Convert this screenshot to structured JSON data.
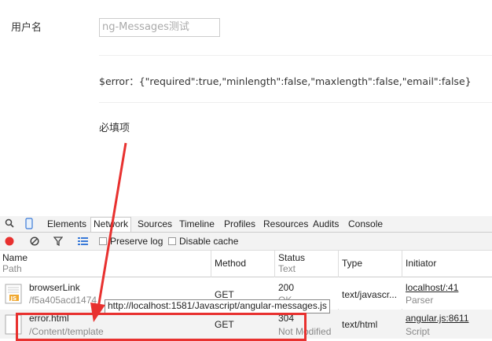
{
  "form": {
    "username_label": "用户名",
    "input_value": "ng-Messages测试",
    "error_text": "$error：{\"required\":true,\"minlength\":false,\"maxlength\":false,\"email\":false}",
    "required_msg": "必填项"
  },
  "devtools": {
    "tabs": [
      "Elements",
      "Network",
      "Sources",
      "Timeline",
      "Profiles",
      "Resources",
      "Audits",
      "Console"
    ],
    "active_tab": "Network",
    "preserve_log": "Preserve log",
    "disable_cache": "Disable cache",
    "headers": {
      "name": "Name",
      "path": "Path",
      "method": "Method",
      "status": "Status",
      "text": "Text",
      "type": "Type",
      "initiator": "Initiator"
    },
    "rows": [
      {
        "name": "browserLink",
        "path": "/f5a405acd1474",
        "method": "GET",
        "status": "200",
        "status_text": "OK",
        "type": "text/javascr...",
        "initiator": "localhost/:41",
        "initiator_sub": "Parser"
      },
      {
        "name": "error.html",
        "path": "/Content/template",
        "method": "GET",
        "status": "304",
        "status_text": "Not Modified",
        "type": "text/html",
        "initiator": "angular.js:8611",
        "initiator_sub": "Script"
      }
    ],
    "tooltip": "http://localhost:1581/Javascript/angular-messages.js"
  },
  "colors": {
    "annotation": "#e8312f",
    "record": "#e8312f"
  }
}
